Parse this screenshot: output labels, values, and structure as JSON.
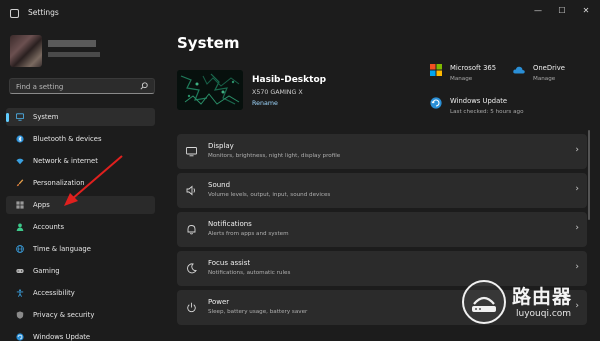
{
  "window": {
    "title": "Settings",
    "controls": {
      "minimize": "—",
      "maximize": "☐",
      "close": "✕"
    }
  },
  "sidebar": {
    "search": {
      "placeholder": "Find a setting",
      "icon": "search-icon"
    },
    "items": [
      {
        "label": "System",
        "icon": "monitor-icon",
        "selected": true
      },
      {
        "label": "Bluetooth & devices",
        "icon": "bluetooth-icon"
      },
      {
        "label": "Network & internet",
        "icon": "wifi-icon"
      },
      {
        "label": "Personalization",
        "icon": "brush-icon"
      },
      {
        "label": "Apps",
        "icon": "apps-icon",
        "hovered": true
      },
      {
        "label": "Accounts",
        "icon": "person-icon"
      },
      {
        "label": "Time & language",
        "icon": "globe-icon"
      },
      {
        "label": "Gaming",
        "icon": "gamepad-icon"
      },
      {
        "label": "Accessibility",
        "icon": "accessibility-icon"
      },
      {
        "label": "Privacy & security",
        "icon": "shield-icon"
      },
      {
        "label": "Windows Update",
        "icon": "update-icon"
      }
    ]
  },
  "main": {
    "title": "System",
    "device": {
      "name": "Hasib-Desktop",
      "model": "X570 GAMING X",
      "rename": "Rename"
    },
    "quick_links": [
      {
        "title": "Microsoft 365",
        "sub": "Manage",
        "icon": "microsoft-icon"
      },
      {
        "title": "OneDrive",
        "sub": "Manage",
        "icon": "cloud-icon"
      },
      {
        "title": "Windows Update",
        "sub": "Last checked: 5 hours ago",
        "icon": "update-icon"
      }
    ],
    "cards": [
      {
        "title": "Display",
        "sub": "Monitors, brightness, night light, display profile",
        "icon": "display-icon"
      },
      {
        "title": "Sound",
        "sub": "Volume levels, output, input, sound devices",
        "icon": "speaker-icon"
      },
      {
        "title": "Notifications",
        "sub": "Alerts from apps and system",
        "icon": "bell-icon"
      },
      {
        "title": "Focus assist",
        "sub": "Notifications, automatic rules",
        "icon": "moon-icon"
      },
      {
        "title": "Power",
        "sub": "Sleep, battery usage, battery saver",
        "icon": "power-icon"
      }
    ],
    "chevron": "›"
  },
  "watermark": {
    "title": "路由器",
    "url": "luyouqi.com"
  },
  "colors": {
    "accent": "#60cdff",
    "background": "#1c1c1c",
    "card": "#2b2b2b",
    "arrow": "#e0201e"
  }
}
